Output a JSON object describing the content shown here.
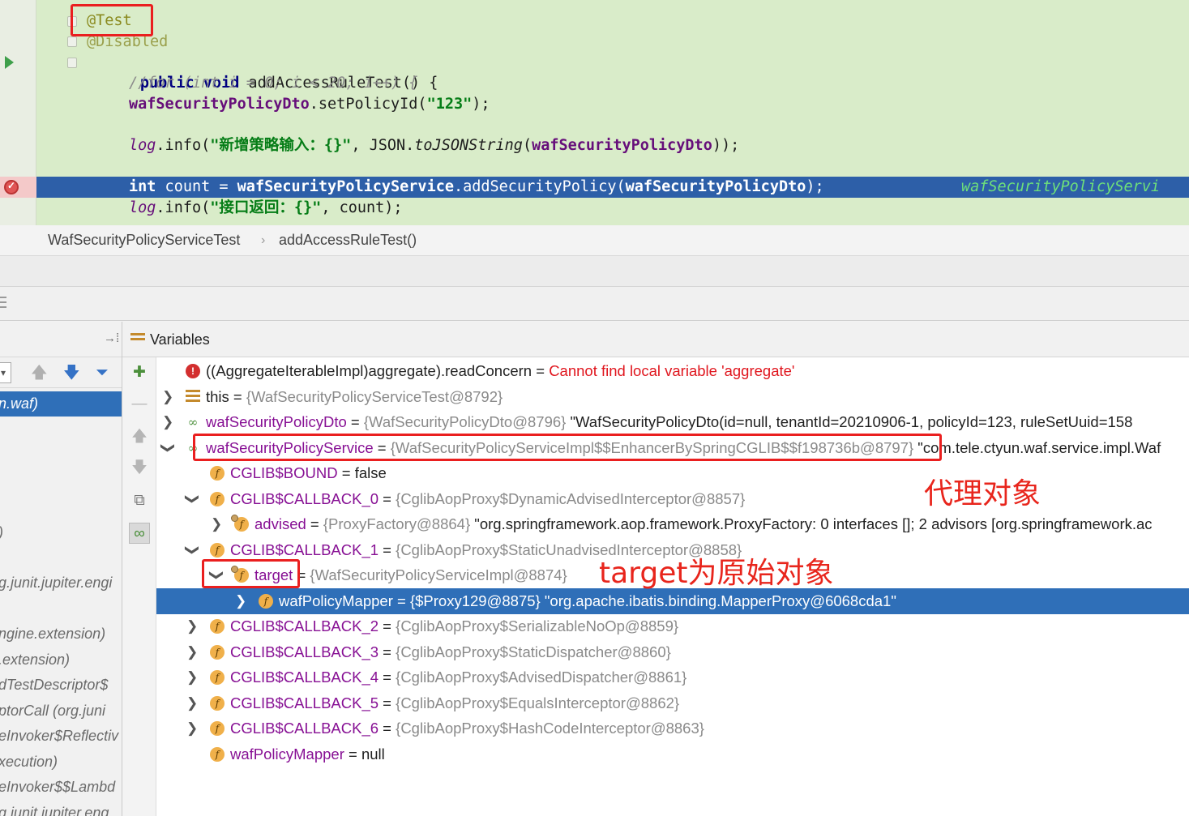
{
  "editor": {
    "lines": {
      "ann_test": "@Test",
      "ann_disabled": "@Disabled",
      "decl_kw1": "public",
      "decl_kw2": "void",
      "decl_rest": " addAccessRuleTest() {",
      "comment_for": "//for (int i = 0; i < 20; i++) {",
      "set_field": "wafSecurityPolicyDto",
      "set_rest": ".setPolicyId(",
      "set_str": "\"123\"",
      "set_end": ");",
      "log1_obj": "log",
      "log1_call": ".info(",
      "log1_str": "\"新增策略输入：{}\"",
      "log1_mid": ", JSON.",
      "log1_static": "toJSONString",
      "log1_paren": "(",
      "log1_field": "wafSecurityPolicyDto",
      "log1_end": "));",
      "exec_kw": "int",
      "exec_var": " count = ",
      "exec_field": "wafSecurityPolicyService",
      "exec_call": ".addSecurityPolicy(",
      "exec_arg": "wafSecurityPolicyDto",
      "exec_end": ");",
      "exec_inline": "wafSecurityPolicyServi",
      "log2_obj": "log",
      "log2_call": ".info(",
      "log2_str": "\"接口返回：{}\"",
      "log2_end": ", count);"
    }
  },
  "breadcrumb": {
    "class_name": "WafSecurityPolicyServiceTest",
    "separator": "›",
    "method_name": "addAccessRuleTest()"
  },
  "frames": {
    "selected": "n.waf)",
    "rows": [
      ")",
      "g.junit.jupiter.engi",
      "ngine.extension)",
      ".extension)",
      "dTestDescriptor$",
      "ptorCall (org.juni",
      "eInvoker$Reflectiv",
      "xecution)",
      "eInvoker$$Lambd",
      "g.junit.jupiter.eng"
    ]
  },
  "variables": {
    "title": "Variables",
    "rows": [
      {
        "name": "((AggregateIterableImpl)aggregate).readConcern",
        "eq": " = ",
        "type": "",
        "value": "Cannot find local variable 'aggregate'"
      },
      {
        "name": "this",
        "eq": " = ",
        "type": "{WafSecurityPolicyServiceTest@8792}",
        "value": ""
      },
      {
        "name": "wafSecurityPolicyDto",
        "eq": " = ",
        "type": "{WafSecurityPolicyDto@8796}",
        "value": " \"WafSecurityPolicyDto(id=null, tenantId=20210906-1, policyId=123, ruleSetUuid=158"
      },
      {
        "name": "wafSecurityPolicyService",
        "eq": " = ",
        "type": "{WafSecurityPolicyServiceImpl$$EnhancerBySpringCGLIB$$f198736b@8797}",
        "value": " \"com.tele.ctyun.waf.service.impl.Waf"
      },
      {
        "name": "CGLIB$BOUND",
        "eq": " = ",
        "type": "",
        "value": "false"
      },
      {
        "name": "CGLIB$CALLBACK_0",
        "eq": " = ",
        "type": "{CglibAopProxy$DynamicAdvisedInterceptor@8857}",
        "value": ""
      },
      {
        "name": "advised",
        "eq": " = ",
        "type": "{ProxyFactory@8864}",
        "value": " \"org.springframework.aop.framework.ProxyFactory: 0 interfaces []; 2 advisors [org.springframework.ac"
      },
      {
        "name": "CGLIB$CALLBACK_1",
        "eq": " = ",
        "type": "{CglibAopProxy$StaticUnadvisedInterceptor@8858}",
        "value": ""
      },
      {
        "name": "target",
        "eq": " = ",
        "type": "{WafSecurityPolicyServiceImpl@8874}",
        "value": ""
      },
      {
        "name": "wafPolicyMapper",
        "eq": " = ",
        "type": "{$Proxy129@8875}",
        "value": " \"org.apache.ibatis.binding.MapperProxy@6068cda1\""
      },
      {
        "name": "CGLIB$CALLBACK_2",
        "eq": " = ",
        "type": "{CglibAopProxy$SerializableNoOp@8859}",
        "value": ""
      },
      {
        "name": "CGLIB$CALLBACK_3",
        "eq": " = ",
        "type": "{CglibAopProxy$StaticDispatcher@8860}",
        "value": ""
      },
      {
        "name": "CGLIB$CALLBACK_4",
        "eq": " = ",
        "type": "{CglibAopProxy$AdvisedDispatcher@8861}",
        "value": ""
      },
      {
        "name": "CGLIB$CALLBACK_5",
        "eq": " = ",
        "type": "{CglibAopProxy$EqualsInterceptor@8862}",
        "value": ""
      },
      {
        "name": "CGLIB$CALLBACK_6",
        "eq": " = ",
        "type": "{CglibAopProxy$HashCodeInterceptor@8863}",
        "value": ""
      },
      {
        "name": "wafPolicyMapper",
        "eq": " = ",
        "type": "",
        "value": "null"
      }
    ]
  },
  "annotations": {
    "proxy_note": "代理对象",
    "target_note": "target为原始对象"
  },
  "colors": {
    "annotation_red": "#ea1f1f",
    "selection_blue": "#2f6fb8",
    "exec_line_blue": "#2d5fa8",
    "editor_bg": "#d9ecc9"
  }
}
